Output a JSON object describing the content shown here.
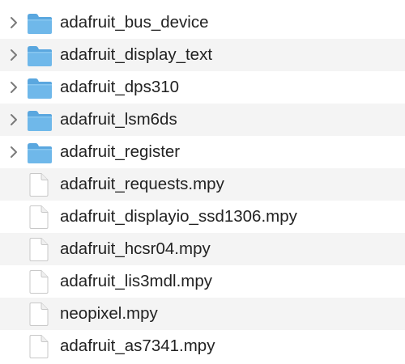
{
  "items": [
    {
      "name": "adafruit_bus_device",
      "kind": "folder",
      "expandable": true
    },
    {
      "name": "adafruit_display_text",
      "kind": "folder",
      "expandable": true
    },
    {
      "name": "adafruit_dps310",
      "kind": "folder",
      "expandable": true
    },
    {
      "name": "adafruit_lsm6ds",
      "kind": "folder",
      "expandable": true
    },
    {
      "name": "adafruit_register",
      "kind": "folder",
      "expandable": true
    },
    {
      "name": "adafruit_requests.mpy",
      "kind": "file",
      "expandable": false
    },
    {
      "name": "adafruit_displayio_ssd1306.mpy",
      "kind": "file",
      "expandable": false
    },
    {
      "name": "adafruit_hcsr04.mpy",
      "kind": "file",
      "expandable": false
    },
    {
      "name": "adafruit_lis3mdl.mpy",
      "kind": "file",
      "expandable": false
    },
    {
      "name": "neopixel.mpy",
      "kind": "file",
      "expandable": false
    },
    {
      "name": "adafruit_as7341.mpy",
      "kind": "file",
      "expandable": false
    }
  ],
  "icons": {
    "folder": "folder-icon",
    "file": "document-icon",
    "disclosure": "chevron-right-icon"
  },
  "colors": {
    "row_alt": "#f4f4f4",
    "folder_body": "#6fb8ea",
    "folder_tab": "#5aa7df",
    "text": "#222222",
    "chevron": "#7a7a7a"
  }
}
